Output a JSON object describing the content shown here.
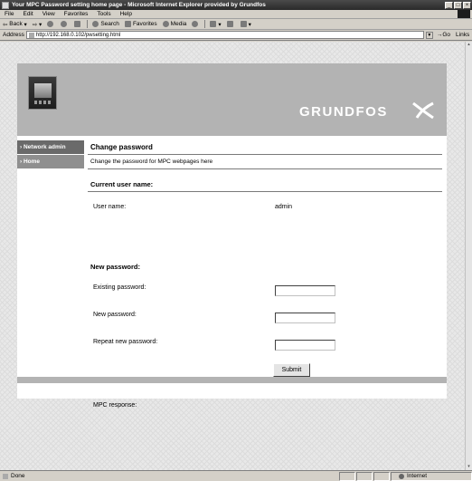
{
  "window": {
    "title": "Your MPC Password setting home page - Microsoft Internet Explorer provided by Grundfos",
    "controls": [
      "_",
      "□",
      "×"
    ]
  },
  "menu": {
    "items": [
      "File",
      "Edit",
      "View",
      "Favorites",
      "Tools",
      "Help"
    ]
  },
  "toolbar": {
    "back": "Back",
    "search": "Search",
    "favorites": "Favorites",
    "media": "Media"
  },
  "address": {
    "label": "Address",
    "url": "http://192.168.0.102/pwsetting.html",
    "go": "Go",
    "links": "Links"
  },
  "page": {
    "logo_text": "GRUNDFOS",
    "nav": [
      "› Network admin",
      "› Home"
    ],
    "heading": "Change password",
    "description": "Change the password for MPC webpages here",
    "current_section": "Current user name:",
    "user_name_label": "User name:",
    "user_name_value": "admin",
    "new_section": "New password:",
    "existing_label": "Existing password:",
    "new_label": "New password:",
    "repeat_label": "Repeat new password:",
    "existing_value": "",
    "new_value": "",
    "repeat_value": "",
    "submit": "Submit",
    "response_label": "MPC response:"
  },
  "status": {
    "text": "Done",
    "zone": "Internet"
  }
}
